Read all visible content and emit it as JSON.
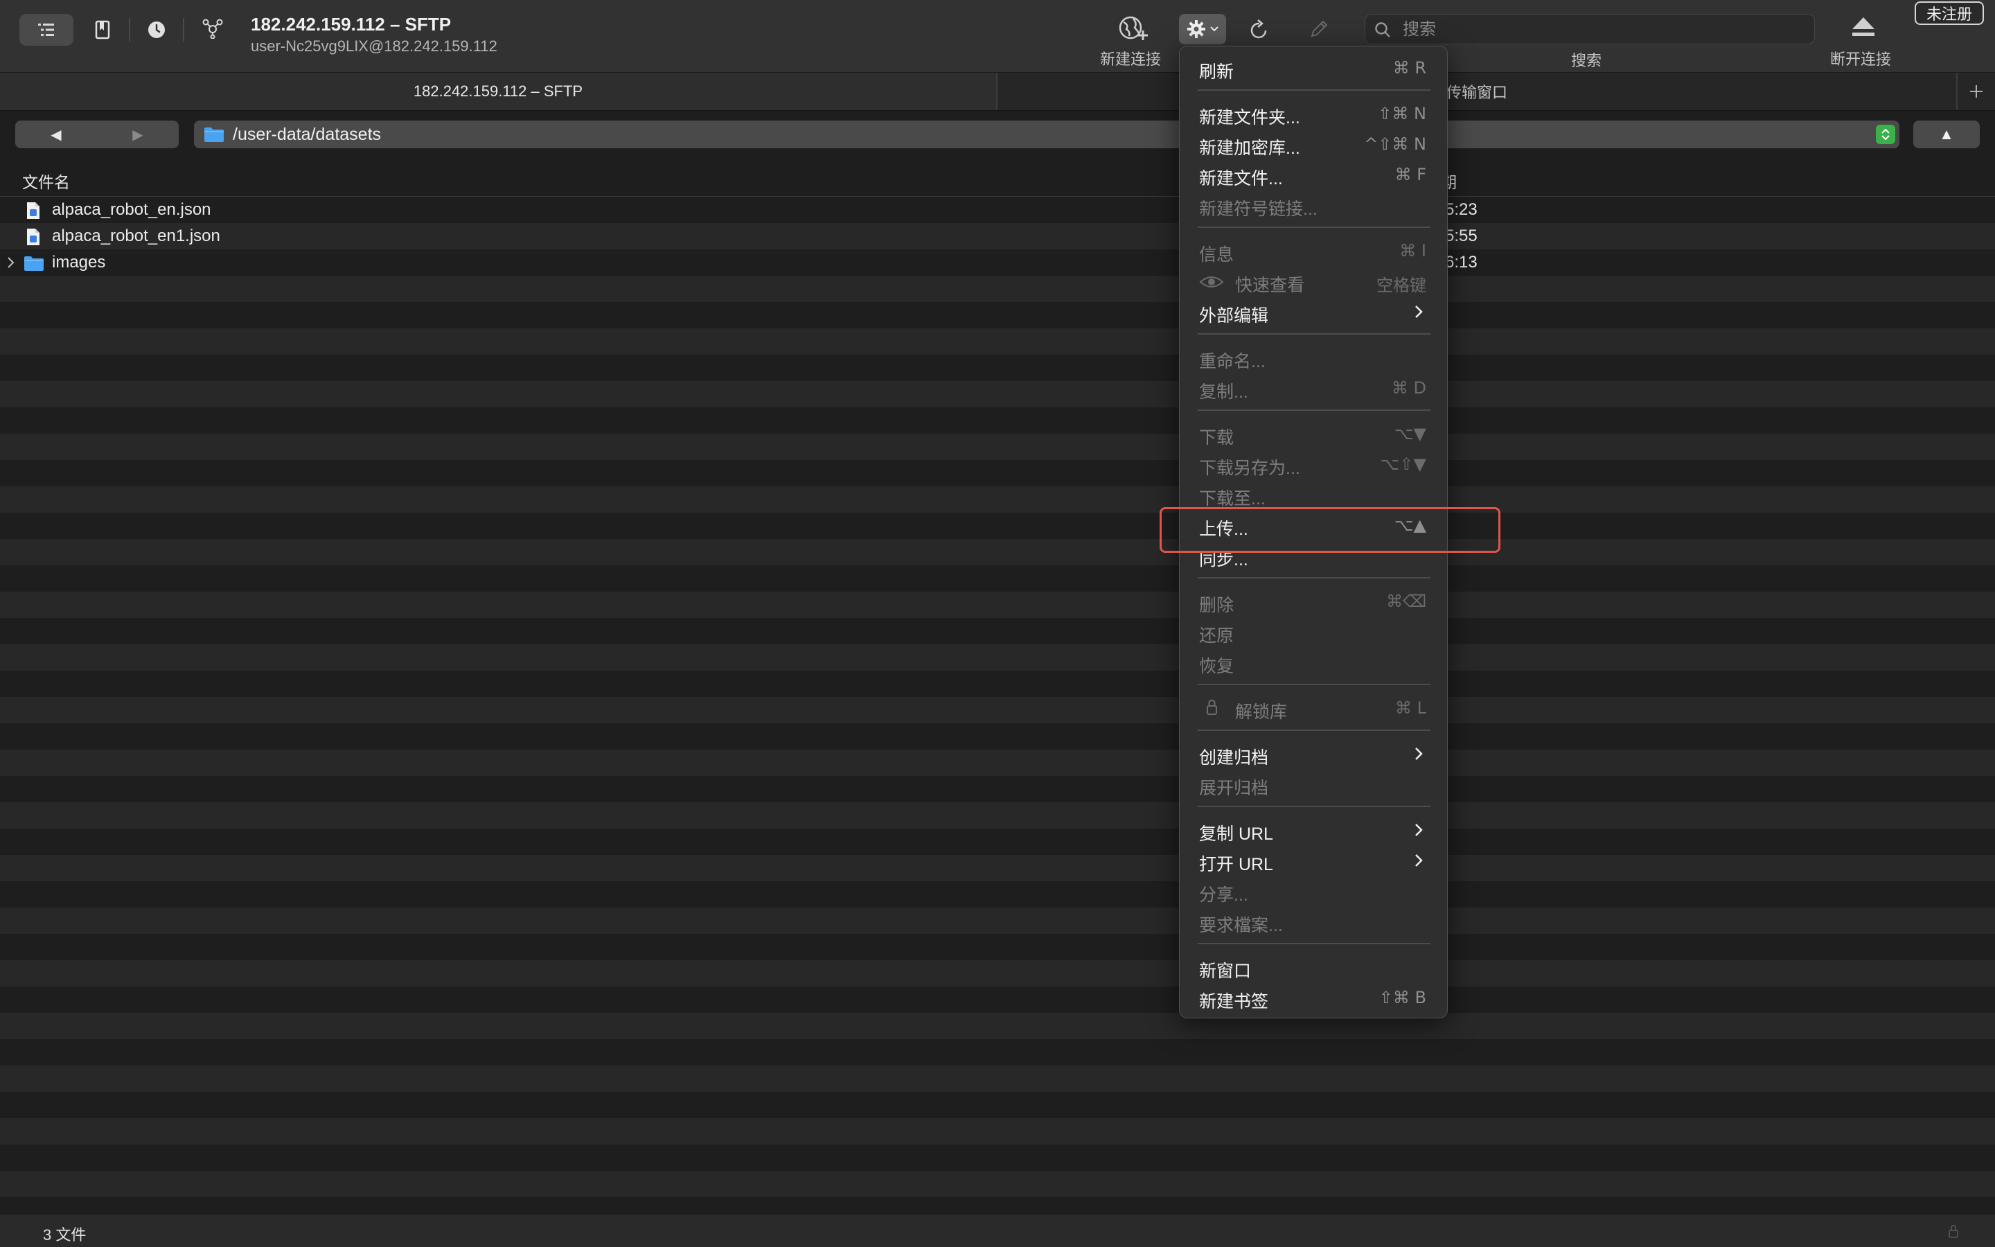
{
  "window": {
    "title": "182.242.159.112 – SFTP",
    "subtitle": "user-Nc25vg9LIX@182.242.159.112"
  },
  "toolbar": {
    "new_connection_label": "新建连接",
    "search_label": "搜索",
    "search_placeholder": "搜索",
    "disconnect_label": "断开连接",
    "unregistered_badge": "未注册"
  },
  "tabs": [
    {
      "label": "182.242.159.112 – SFTP"
    },
    {
      "label": "传输窗口"
    }
  ],
  "pathbar": {
    "path": "/user-data/datasets",
    "up_symbol": "▲",
    "back_symbol": "◀",
    "forward_symbol": "▶"
  },
  "file_list": {
    "columns": {
      "name": "文件名",
      "date": "期"
    },
    "rows": [
      {
        "name": "alpaca_robot_en.json",
        "date": "5:23",
        "type": "json-file-icon"
      },
      {
        "name": "alpaca_robot_en1.json",
        "date": "5:55",
        "type": "json-file-icon"
      },
      {
        "name": "images",
        "date": "6:13",
        "type": "folder-icon"
      }
    ]
  },
  "status": {
    "text": "3 文件"
  },
  "menu": {
    "items": [
      {
        "label": "刷新",
        "shortcut": "⌘ R",
        "enabled": true
      },
      {
        "label": "新建文件夹...",
        "shortcut": "⇧⌘ N",
        "enabled": true
      },
      {
        "label": "新建加密库...",
        "shortcut": "^⇧⌘ N",
        "enabled": true
      },
      {
        "label": "新建文件...",
        "shortcut": "⌘ F",
        "enabled": true
      },
      {
        "label": "新建符号链接...",
        "shortcut": "",
        "enabled": false
      },
      {
        "label": "信息",
        "shortcut": "⌘ I",
        "enabled": false
      },
      {
        "label": "快速查看",
        "shortcut": "空格键",
        "enabled": false
      },
      {
        "label": "外部编辑",
        "shortcut": "",
        "enabled": true
      },
      {
        "label": "重命名...",
        "shortcut": "",
        "enabled": false
      },
      {
        "label": "复制...",
        "shortcut": "⌘ D",
        "enabled": false
      },
      {
        "label": "下载",
        "shortcut": "⌥▼",
        "enabled": false
      },
      {
        "label": "下载另存为...",
        "shortcut": "⌥⇧▼",
        "enabled": false
      },
      {
        "label": "下载至...",
        "shortcut": "",
        "enabled": false
      },
      {
        "label": "上传...",
        "shortcut": "⌥▲",
        "enabled": true
      },
      {
        "label": "同步...",
        "shortcut": "",
        "enabled": true
      },
      {
        "label": "删除",
        "shortcut": "⌘⌫",
        "enabled": false
      },
      {
        "label": "还原",
        "shortcut": "",
        "enabled": false
      },
      {
        "label": "恢复",
        "shortcut": "",
        "enabled": false
      },
      {
        "label": "解锁库",
        "shortcut": "⌘ L",
        "enabled": false
      },
      {
        "label": "创建归档",
        "shortcut": "",
        "enabled": true
      },
      {
        "label": "展开归档",
        "shortcut": "",
        "enabled": false
      },
      {
        "label": "复制 URL",
        "shortcut": "",
        "enabled": true
      },
      {
        "label": "打开 URL",
        "shortcut": "",
        "enabled": true
      },
      {
        "label": "分享...",
        "shortcut": "",
        "enabled": false
      },
      {
        "label": "要求檔案...",
        "shortcut": "",
        "enabled": false
      },
      {
        "label": "新窗口",
        "shortcut": "",
        "enabled": true
      },
      {
        "label": "新建书签",
        "shortcut": "⇧⌘ B",
        "enabled": true
      }
    ]
  },
  "colors": {
    "highlight": "#e0564a",
    "accent_green": "#3bb14a",
    "folder_blue": "#4aa3f0"
  }
}
